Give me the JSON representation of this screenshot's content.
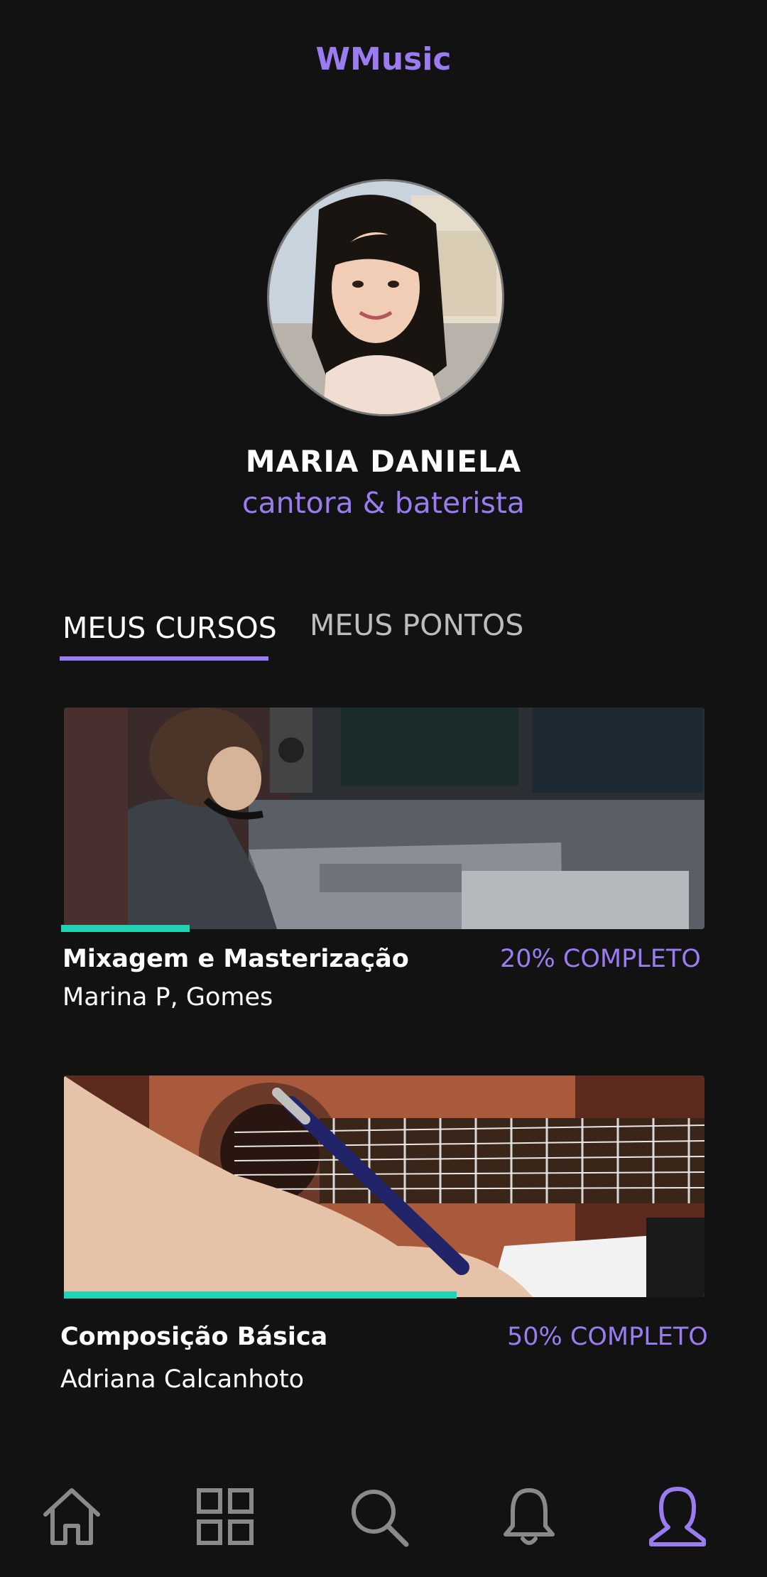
{
  "app": {
    "title": "WMusic"
  },
  "colors": {
    "accent": "#9b7cf0",
    "progress": "#1fd3b4",
    "background": "#121212",
    "inactive_icon": "#8a8a8a"
  },
  "profile": {
    "name": "MARIA DANIELA",
    "role": "cantora & baterista",
    "avatar_icon": "profile-photo"
  },
  "tabs": [
    {
      "label": "MEUS CURSOS",
      "active": true
    },
    {
      "label": "MEUS PONTOS",
      "active": false
    }
  ],
  "courses": [
    {
      "title": "Mixagem e Masterização",
      "author": "Marina P, Gomes",
      "status": "20% COMPLETO",
      "progress": 0.2,
      "image_icon": "mixing-console-photo"
    },
    {
      "title": "Composição Básica",
      "author": "Adriana Calcanhoto",
      "status": "50% COMPLETO",
      "progress": 0.5,
      "image_icon": "guitar-writing-photo"
    }
  ],
  "bottom_nav": [
    {
      "icon": "home-icon",
      "active": false
    },
    {
      "icon": "grid-icon",
      "active": false
    },
    {
      "icon": "search-icon",
      "active": false
    },
    {
      "icon": "bell-icon",
      "active": false
    },
    {
      "icon": "profile-icon",
      "active": true
    }
  ]
}
